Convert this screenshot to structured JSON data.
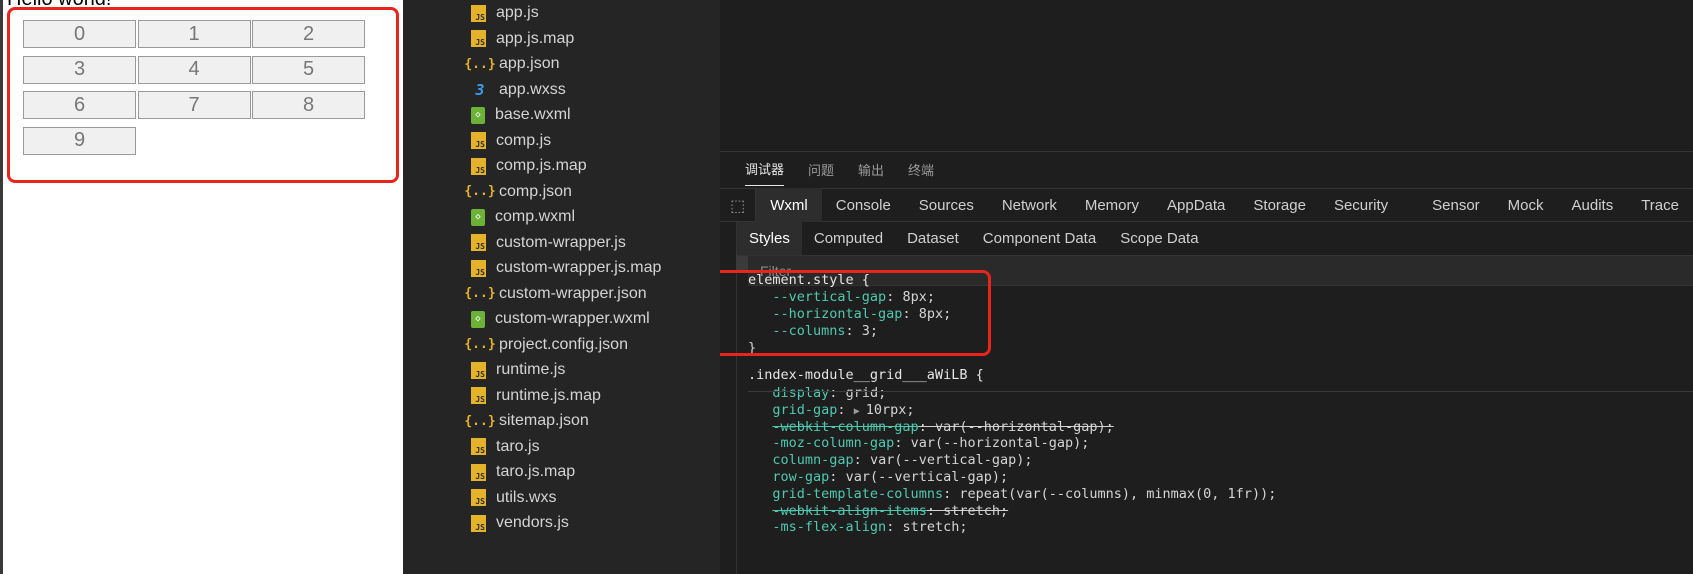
{
  "preview": {
    "title": "Hello world!",
    "grid_items": [
      "0",
      "1",
      "2",
      "3",
      "4",
      "5",
      "6",
      "7",
      "8",
      "9"
    ]
  },
  "file_tree": [
    {
      "name": "app.js",
      "icon": "js-file-icon"
    },
    {
      "name": "app.js.map",
      "icon": "js-map-file-icon"
    },
    {
      "name": "app.json",
      "icon": "json-file-icon"
    },
    {
      "name": "app.wxss",
      "icon": "wxss-file-icon"
    },
    {
      "name": "base.wxml",
      "icon": "wxml-file-icon"
    },
    {
      "name": "comp.js",
      "icon": "js-file-icon"
    },
    {
      "name": "comp.js.map",
      "icon": "js-map-file-icon"
    },
    {
      "name": "comp.json",
      "icon": "json-file-icon"
    },
    {
      "name": "comp.wxml",
      "icon": "wxml-file-icon"
    },
    {
      "name": "custom-wrapper.js",
      "icon": "js-file-icon"
    },
    {
      "name": "custom-wrapper.js.map",
      "icon": "js-map-file-icon"
    },
    {
      "name": "custom-wrapper.json",
      "icon": "json-file-icon"
    },
    {
      "name": "custom-wrapper.wxml",
      "icon": "wxml-file-icon"
    },
    {
      "name": "project.config.json",
      "icon": "json-file-icon"
    },
    {
      "name": "runtime.js",
      "icon": "js-file-icon"
    },
    {
      "name": "runtime.js.map",
      "icon": "js-map-file-icon"
    },
    {
      "name": "sitemap.json",
      "icon": "json-file-icon"
    },
    {
      "name": "taro.js",
      "icon": "js-file-icon"
    },
    {
      "name": "taro.js.map",
      "icon": "js-map-file-icon"
    },
    {
      "name": "utils.wxs",
      "icon": "js-file-icon"
    },
    {
      "name": "vendors.js",
      "icon": "js-file-icon"
    }
  ],
  "panel_tabs": [
    "调试器",
    "问题",
    "输出",
    "终端"
  ],
  "tool_tabs": [
    "Wxml",
    "Console",
    "Sources",
    "Network",
    "Memory",
    "AppData",
    "Storage",
    "Security",
    "Sensor",
    "Mock",
    "Audits",
    "Trace"
  ],
  "sub_tabs": [
    "Styles",
    "Computed",
    "Dataset",
    "Component Data",
    "Scope Data"
  ],
  "filter_placeholder": "Filter",
  "styles": {
    "element_rule": {
      "selector": "element.style {",
      "props": [
        {
          "name": "--vertical-gap",
          "value": "8px;"
        },
        {
          "name": "--horizontal-gap",
          "value": "8px;"
        },
        {
          "name": "--columns",
          "value": "3;"
        }
      ],
      "close": "}"
    },
    "class_rule": {
      "selector": ".index-module__grid___aWiLB {",
      "props": [
        {
          "name": "display",
          "value": "grid;",
          "struck": false
        },
        {
          "name": "grid-gap",
          "value": "10rpx;",
          "struck": false,
          "expandable": true
        },
        {
          "name": "-webkit-column-gap",
          "value": "var(--horizontal-gap);",
          "struck": true
        },
        {
          "name": "-moz-column-gap",
          "value": "var(--horizontal-gap);",
          "struck": false
        },
        {
          "name": "column-gap",
          "value": "var(--vertical-gap);",
          "struck": false
        },
        {
          "name": "row-gap",
          "value": "var(--vertical-gap);",
          "struck": false
        },
        {
          "name": "grid-template-columns",
          "value": "repeat(var(--columns), minmax(0, 1fr));",
          "struck": false
        },
        {
          "name": "-webkit-align-items",
          "value": "stretch;",
          "struck": true
        },
        {
          "name": "-ms-flex-align",
          "value": "stretch;",
          "struck": false
        }
      ]
    }
  },
  "colors": {
    "highlight": "#e8241c",
    "property": "#4ec9b0",
    "background": "#1e1e1e"
  }
}
